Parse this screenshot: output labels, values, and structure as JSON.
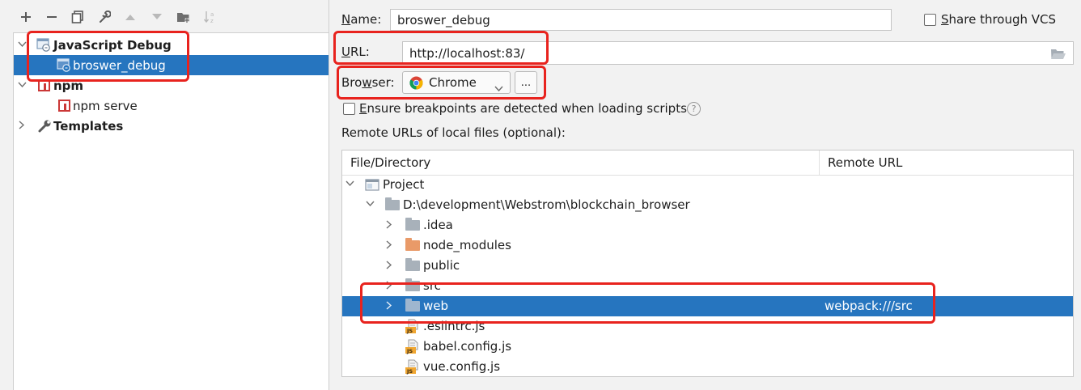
{
  "toolbar": {
    "icons": [
      "add-icon",
      "remove-icon",
      "copy-icon",
      "wrench-icon",
      "move-up-icon",
      "move-down-icon",
      "new-folder-icon",
      "sort-alpha-icon"
    ]
  },
  "tree": {
    "items": [
      {
        "label": "JavaScript Debug",
        "bold": true,
        "icon": "js-debug-icon"
      },
      {
        "label": "broswer_debug",
        "bold": false,
        "icon": "js-debug-config-icon",
        "selected": true
      },
      {
        "label": "npm",
        "bold": true,
        "icon": "npm-icon"
      },
      {
        "label": "npm serve",
        "bold": false,
        "icon": "npm-icon"
      },
      {
        "label": "Templates",
        "bold": true,
        "icon": "wrench-icon"
      }
    ]
  },
  "form": {
    "name_label_mn": "N",
    "name_label_rest": "ame:",
    "name_value": "broswer_debug",
    "share_vcs_label_mn": "S",
    "share_vcs_label_rest": "hare through VCS",
    "url_label_mn": "U",
    "url_label_rest": "RL:",
    "url_value": "http://localhost:83/",
    "browser_label_pre": "Bro",
    "browser_label_mn": "w",
    "browser_label_rest": "ser:",
    "browser_value": "Chrome",
    "browse_button": "...",
    "ensure_mn": "E",
    "ensure_rest": "nsure breakpoints are detected when loading scripts",
    "help_glyph": "?",
    "remote_urls_label": "Remote URLs of local files (optional):"
  },
  "table": {
    "columns": [
      "File/Directory",
      "Remote URL"
    ],
    "rows": [
      {
        "label": "Project",
        "remote": "",
        "icon": "project-icon"
      },
      {
        "label": "D:\\development\\Webstrom\\blockchain_browser",
        "remote": "",
        "icon": "folder-icon"
      },
      {
        "label": ".idea",
        "remote": "",
        "icon": "folder-icon"
      },
      {
        "label": "node_modules",
        "remote": "",
        "icon": "folder-orange-icon"
      },
      {
        "label": "public",
        "remote": "",
        "icon": "folder-icon"
      },
      {
        "label": "src",
        "remote": "",
        "icon": "folder-icon"
      },
      {
        "label": "web",
        "remote": "webpack:///src",
        "icon": "folder-icon",
        "selected": true
      },
      {
        "label": ".eslintrc.js",
        "remote": "",
        "icon": "js-file-icon"
      },
      {
        "label": "babel.config.js",
        "remote": "",
        "icon": "js-file-icon"
      },
      {
        "label": "vue.config.js",
        "remote": "",
        "icon": "js-file-icon"
      }
    ]
  },
  "colors": {
    "selection": "#2675bf",
    "highlight": "#e8231e"
  }
}
